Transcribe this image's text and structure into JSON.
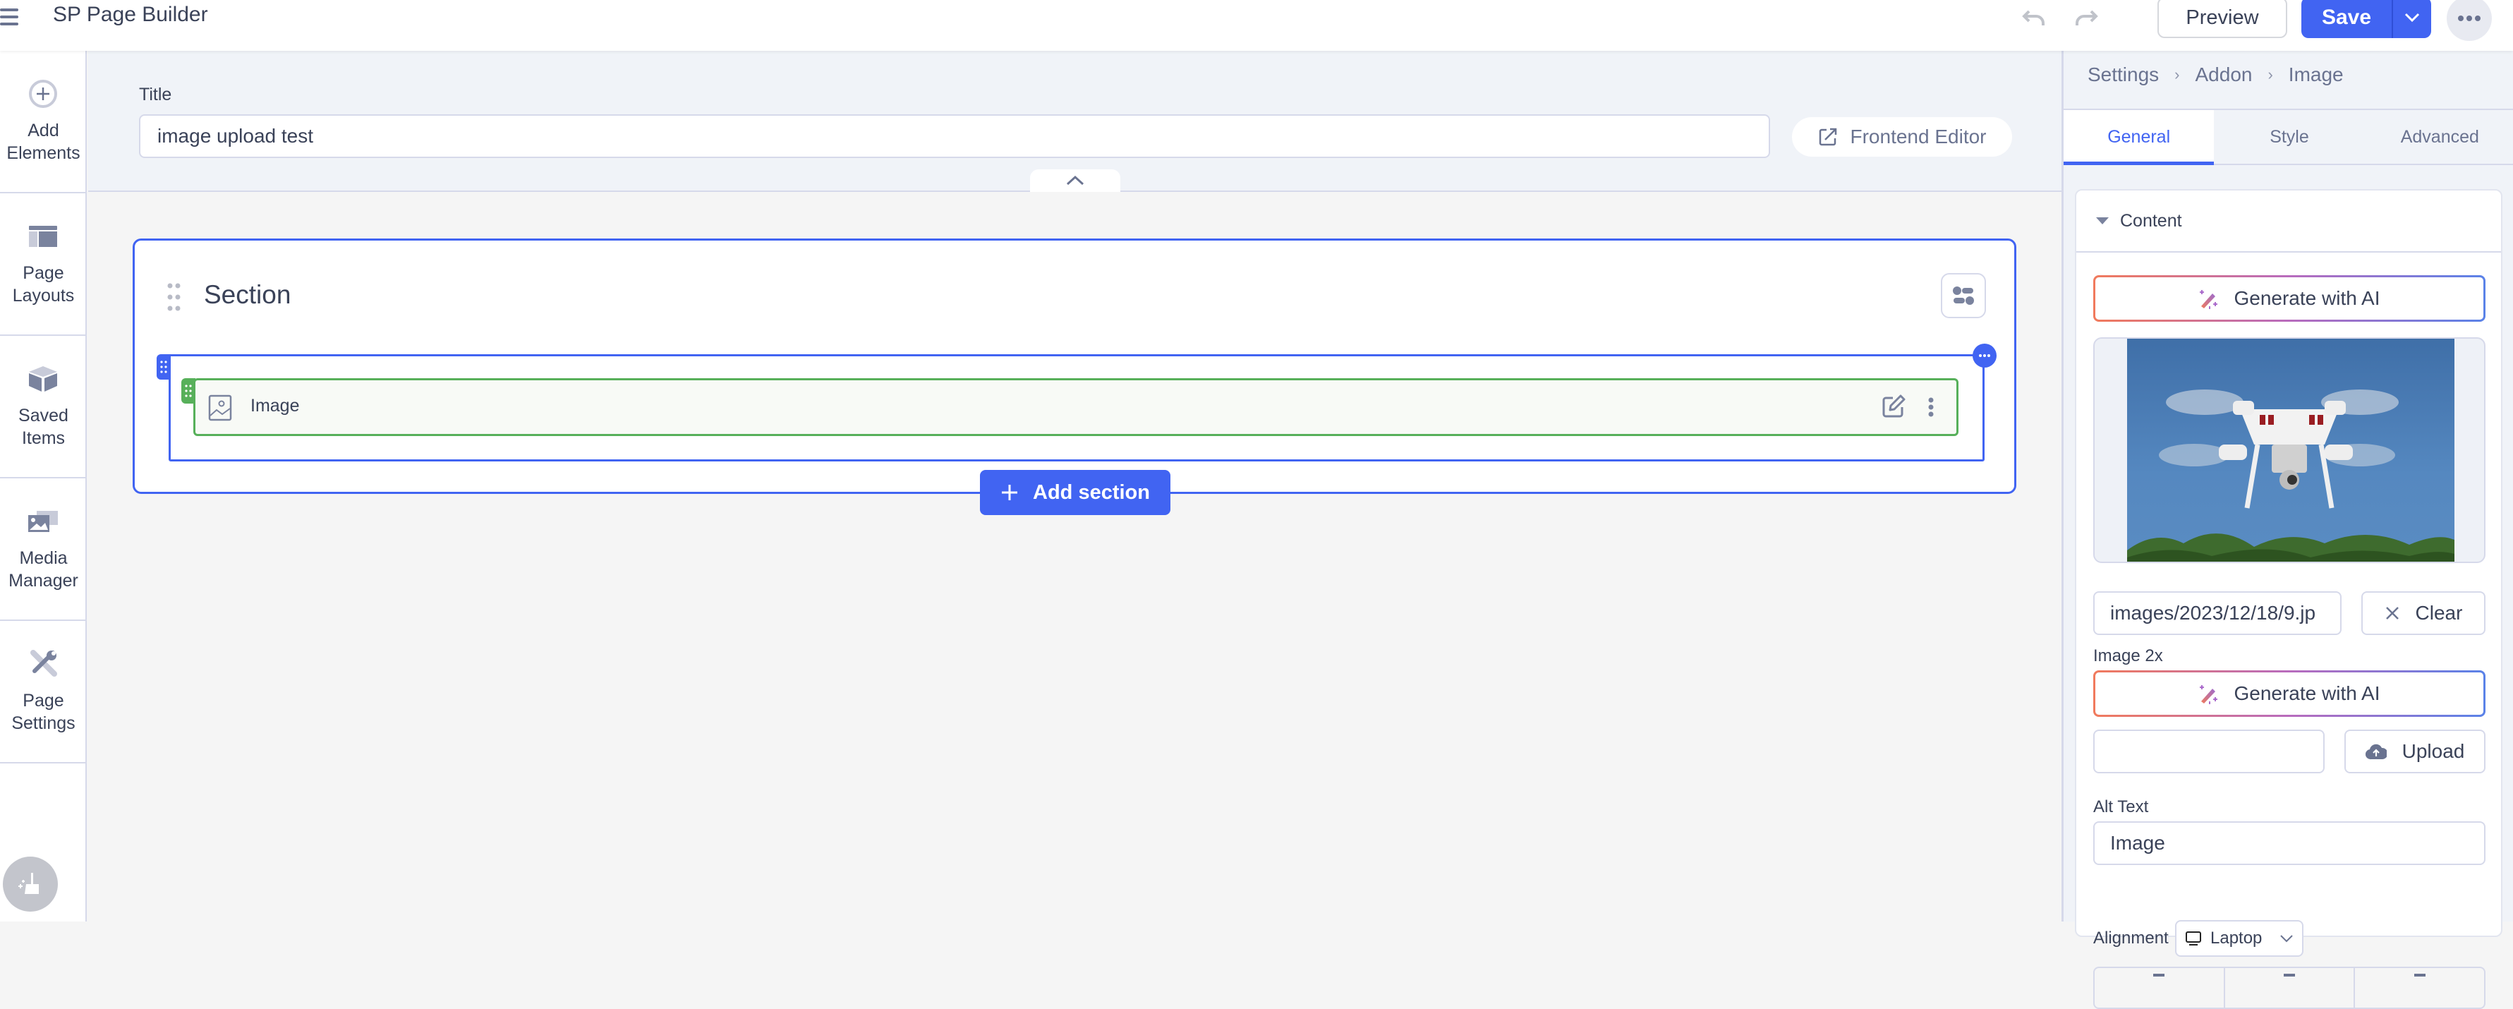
{
  "header": {
    "app_title": "SP Page Builder",
    "menu_icon": "hamburger-icon",
    "undo_icon": "undo-icon",
    "redo_icon": "redo-icon",
    "preview_label": "Preview",
    "save_label": "Save",
    "more_label": "•••"
  },
  "sidebar": {
    "items": [
      {
        "label": "Add\nElements",
        "icon": "plus-circle-icon"
      },
      {
        "label": "Page\nLayouts",
        "icon": "layout-icon"
      },
      {
        "label": "Saved\nItems",
        "icon": "cube-icon"
      },
      {
        "label": "Media\nManager",
        "icon": "media-icon"
      },
      {
        "label": "Page\nSettings",
        "icon": "tools-icon"
      }
    ],
    "bottom_icon": "broom-icon"
  },
  "title_area": {
    "label": "Title",
    "value": "image upload test",
    "frontend_editor_label": "Frontend Editor"
  },
  "canvas": {
    "section_title": "Section",
    "addon_label": "Image",
    "add_section_label": "Add section",
    "colors": {
      "selection": "#4164f2",
      "addon": "#57b05a"
    }
  },
  "right_panel": {
    "breadcrumb": [
      "Settings",
      "Addon",
      "Image"
    ],
    "tabs": [
      {
        "label": "General",
        "active": true
      },
      {
        "label": "Style",
        "active": false
      },
      {
        "label": "Advanced",
        "active": false
      }
    ],
    "content_group": {
      "title": "Content",
      "generate_ai_label": "Generate with AI",
      "image_path": "images/2023/12/18/9.jp",
      "clear_label": "Clear",
      "image2x_label": "Image 2x",
      "generate_ai_label_2x": "Generate with AI",
      "image2x_value": "",
      "upload_label": "Upload",
      "alt_text_label": "Alt Text",
      "alt_text_value": "Image",
      "alignment_label": "Alignment",
      "device_value": "Laptop"
    }
  }
}
